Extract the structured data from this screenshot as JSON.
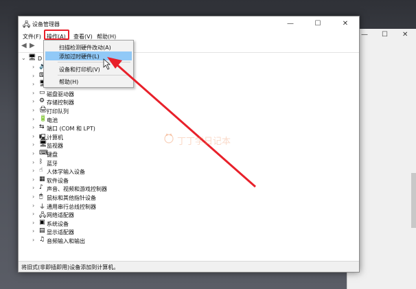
{
  "window": {
    "title": "设备管理器",
    "controls": {
      "minimize": "—",
      "maximize": "☐",
      "close": "✕"
    }
  },
  "background_window": {
    "controls": {
      "minimize": "—",
      "maximize": "☐",
      "close": "✕"
    }
  },
  "menubar": {
    "items": [
      "文件(F)",
      "操作(A)",
      "查看(V)",
      "帮助(H)"
    ]
  },
  "dropdown": {
    "items": [
      {
        "label": "扫描检测硬件改动(A)",
        "highlighted": false
      },
      {
        "label": "添加过时硬件(L)",
        "highlighted": true
      },
      {
        "label": "设备和打印机(V)",
        "highlighted": false
      },
      {
        "label": "帮助(H)",
        "highlighted": false
      }
    ]
  },
  "tree": {
    "root": {
      "label": "D"
    },
    "items": [
      {
        "icon": "audio-icon",
        "label": ""
      },
      {
        "icon": "keyboard-icon",
        "label": ""
      },
      {
        "icon": "monitor-icon",
        "label": ""
      },
      {
        "icon": "disk-icon",
        "label": "磁盘驱动器"
      },
      {
        "icon": "storage-icon",
        "label": "存储控制器"
      },
      {
        "icon": "printer-icon",
        "label": "打印队列"
      },
      {
        "icon": "battery-icon",
        "label": "电池"
      },
      {
        "icon": "port-icon",
        "label": "端口 (COM 和 LPT)"
      },
      {
        "icon": "computer-icon",
        "label": "计算机"
      },
      {
        "icon": "monitor-icon",
        "label": "监视器"
      },
      {
        "icon": "keyboard-icon",
        "label": "键盘"
      },
      {
        "icon": "bluetooth-icon",
        "label": "蓝牙"
      },
      {
        "icon": "hid-icon",
        "label": "人体学输入设备"
      },
      {
        "icon": "software-icon",
        "label": "软件设备"
      },
      {
        "icon": "sound-icon",
        "label": "声音、视频和游戏控制器"
      },
      {
        "icon": "mouse-icon",
        "label": "鼠标和其他指针设备"
      },
      {
        "icon": "usb-icon",
        "label": "通用串行总线控制器"
      },
      {
        "icon": "network-icon",
        "label": "网络适配器"
      },
      {
        "icon": "system-icon",
        "label": "系统设备"
      },
      {
        "icon": "display-icon",
        "label": "显示适配器"
      },
      {
        "icon": "audio-io-icon",
        "label": "音频输入和输出"
      }
    ]
  },
  "status": {
    "text": "将旧式(非即插即用)设备添加到计算机。"
  },
  "watermark": {
    "text": "丁丁学日记本"
  },
  "colors": {
    "highlight": "#91c9f7",
    "annotation_red": "#e8202a"
  }
}
